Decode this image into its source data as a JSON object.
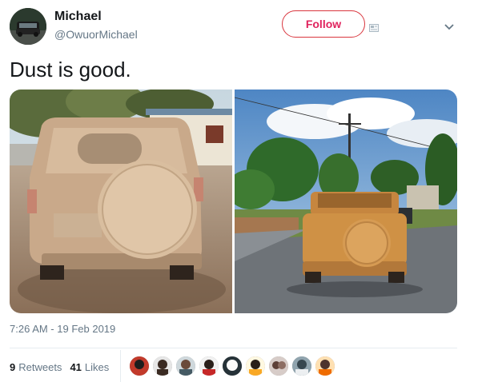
{
  "user": {
    "name": "Michael",
    "handle": "@OwuorMichael"
  },
  "actions": {
    "follow_label": "Follow"
  },
  "tweet": {
    "text": "Dust is good.",
    "timestamp": "7:26 AM - 19 Feb 2019"
  },
  "stats": {
    "retweets_count": "9",
    "retweets_label": "Retweets",
    "likes_count": "41",
    "likes_label": "Likes"
  },
  "icons": [
    "chevron-down-icon",
    "card-icon"
  ],
  "colors": {
    "accent": "#e0245e",
    "secondary_text": "#657786",
    "primary_text": "#14171a",
    "divider": "#e6ecf0"
  }
}
